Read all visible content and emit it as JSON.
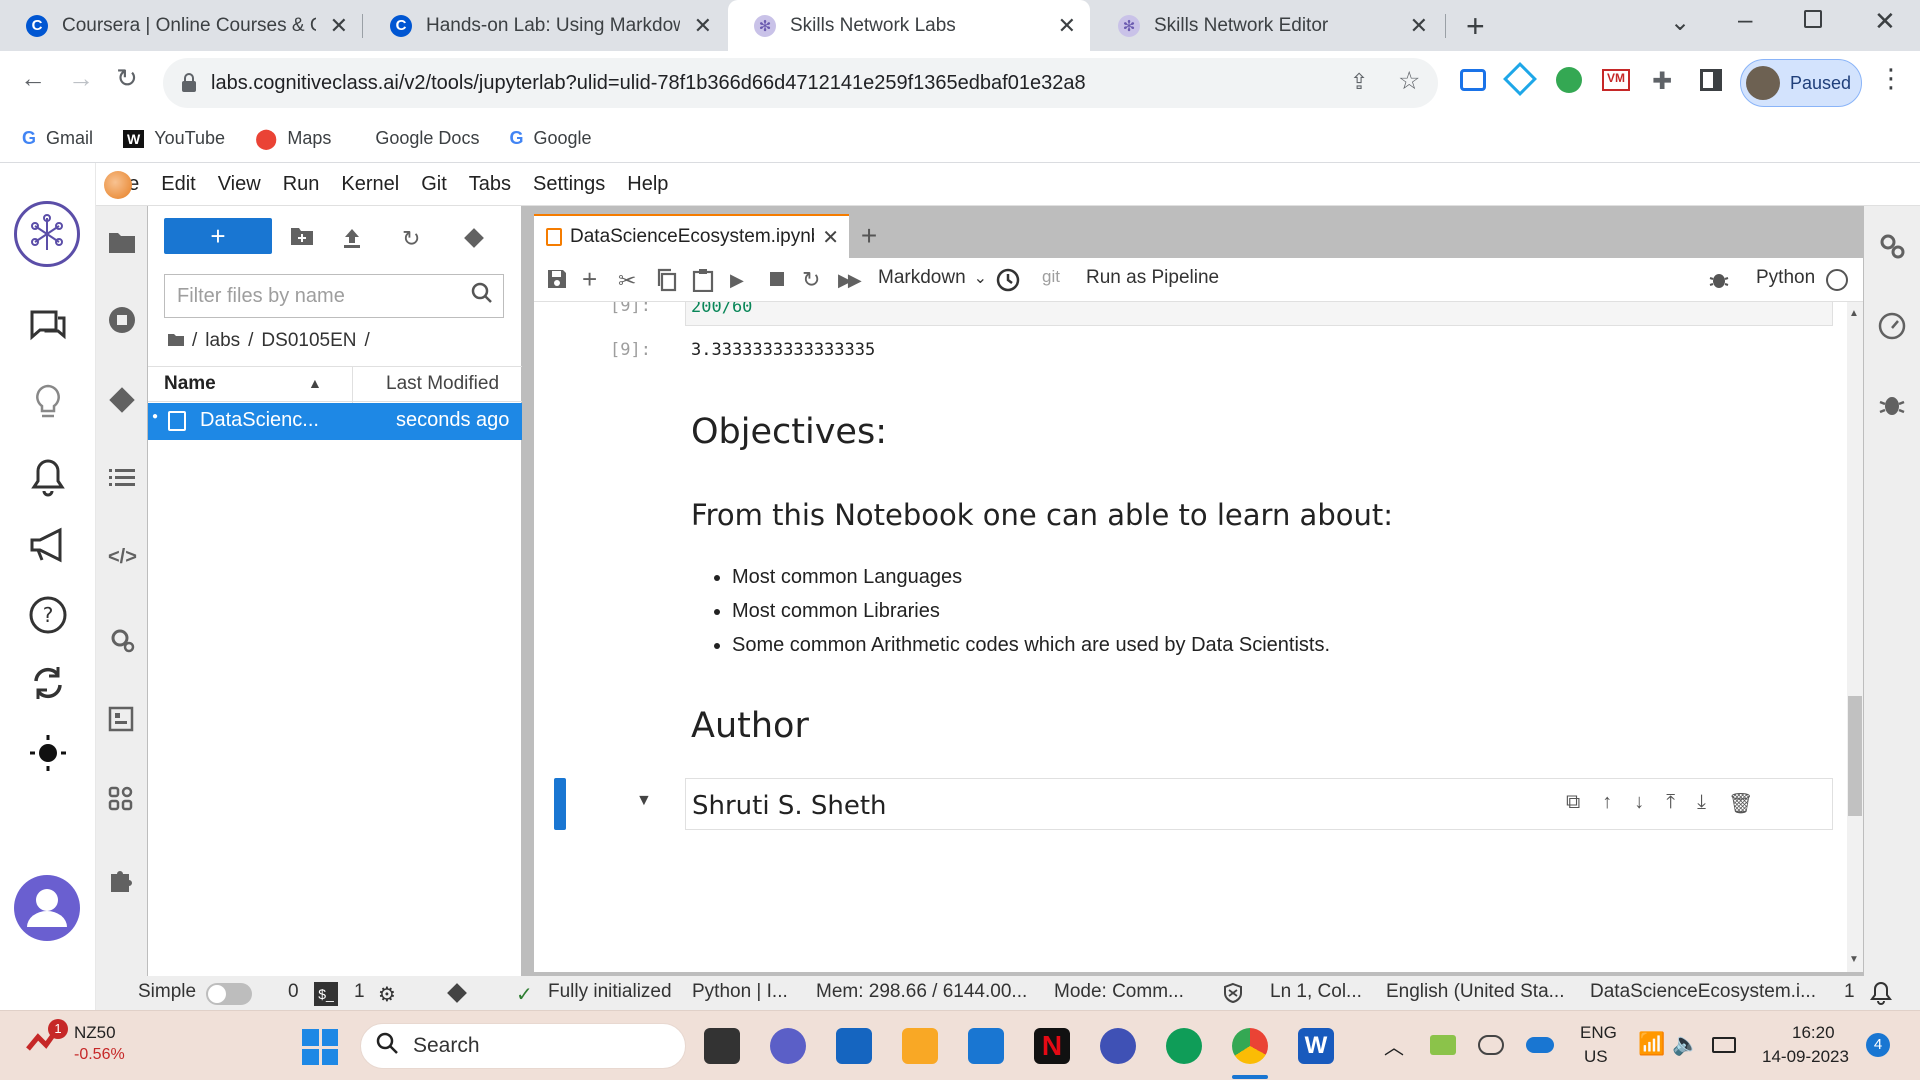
{
  "browser": {
    "tabs": [
      {
        "label": "Coursera | Online Courses & Cre",
        "favicon": "coursera-icon",
        "active": false
      },
      {
        "label": "Hands-on Lab: Using Markdown",
        "favicon": "coursera-icon",
        "active": false
      },
      {
        "label": "Skills Network Labs",
        "favicon": "skills-network-icon",
        "active": true
      },
      {
        "label": "Skills Network Editor",
        "favicon": "skills-network-icon",
        "active": false
      }
    ],
    "url": "labs.cognitiveclass.ai/v2/tools/jupyterlab?ulid=ulid-78f1b366d66d4712141e259f1365edbaf01e32a8",
    "profile_status": "Paused",
    "bookmarks": [
      "Gmail",
      "YouTube",
      "Maps",
      "Google Docs",
      "Google"
    ]
  },
  "jupyter": {
    "menu": [
      "File",
      "Edit",
      "View",
      "Run",
      "Kernel",
      "Git",
      "Tabs",
      "Settings",
      "Help"
    ],
    "filebrowser": {
      "new_label": "+",
      "filter_placeholder": "Filter files by name",
      "breadcrumbs": [
        "/",
        "labs",
        "/",
        "DS0105EN",
        "/"
      ],
      "col_name": "Name",
      "col_modified": "Last Modified",
      "files": [
        {
          "name": "DataScienc...",
          "modified": "seconds ago"
        }
      ]
    },
    "notebook": {
      "tab_title": "DataScienceEcosystem.ipynb",
      "cell_type": "Markdown",
      "git_label": "git",
      "run_pipeline": "Run as Pipeline",
      "kernel": "Python",
      "input_prompt": "[9]:",
      "input_code": "200/60",
      "output_prompt": "[9]:",
      "output_text": "3.3333333333333335",
      "objectives_heading": "Objectives:",
      "learn_heading": "From this Notebook one can able to learn about:",
      "bullets": [
        "Most common Languages",
        "Most common Libraries",
        "Some common Arithmetic codes which are used by Data Scientists."
      ],
      "author_heading": "Author",
      "author_name": "Shruti S. Sheth"
    },
    "status": {
      "mode_label": "Simple",
      "terminals": "0",
      "kernels": "1",
      "init": "Fully initialized",
      "kernel_status": "Python | I...",
      "mem": "Mem: 298.66 / 6144.00...",
      "mode": "Mode: Comm...",
      "cursor": "Ln 1, Col...",
      "language": "English (United Sta...",
      "file": "DataScienceEcosystem.i...",
      "notifications": "1"
    }
  },
  "taskbar": {
    "stock_name": "NZ50",
    "stock_change": "-0.56%",
    "stock_badge": "1",
    "search_label": "Search",
    "lang_top": "ENG",
    "lang_bottom": "US",
    "time": "16:20",
    "date": "14-09-2023",
    "notif_count": "4"
  },
  "colors": {
    "accent": "#1976d2",
    "selection": "#1e88e5",
    "tab_marker": "#f57c00",
    "active_cell": "#1976d2"
  }
}
